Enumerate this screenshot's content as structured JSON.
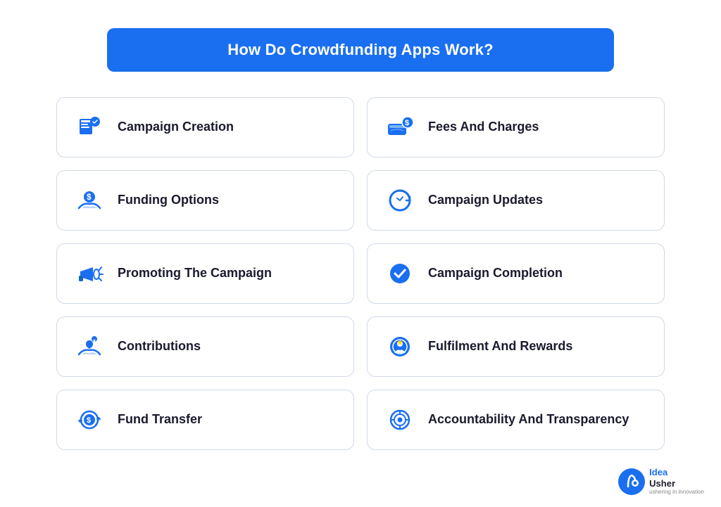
{
  "header": {
    "title": "How Do Crowdfunding Apps Work?"
  },
  "cards": [
    {
      "id": "campaign-creation",
      "label": "Campaign Creation",
      "icon": "campaign-creation-icon",
      "col": "left"
    },
    {
      "id": "fees-and-charges",
      "label": "Fees And Charges",
      "icon": "fees-icon",
      "col": "right"
    },
    {
      "id": "funding-options",
      "label": "Funding Options",
      "icon": "funding-options-icon",
      "col": "left"
    },
    {
      "id": "campaign-updates",
      "label": "Campaign Updates",
      "icon": "campaign-updates-icon",
      "col": "right"
    },
    {
      "id": "promoting-campaign",
      "label": "Promoting The Campaign",
      "icon": "promoting-icon",
      "col": "left"
    },
    {
      "id": "campaign-completion",
      "label": "Campaign Completion",
      "icon": "campaign-completion-icon",
      "col": "right"
    },
    {
      "id": "contributions",
      "label": "Contributions",
      "icon": "contributions-icon",
      "col": "left"
    },
    {
      "id": "fulfilment-rewards",
      "label": "Fulfilment And Rewards",
      "icon": "rewards-icon",
      "col": "right"
    },
    {
      "id": "fund-transfer",
      "label": "Fund Transfer",
      "icon": "fund-transfer-icon",
      "col": "left"
    },
    {
      "id": "accountability",
      "label": "Accountability And Transparency",
      "icon": "accountability-icon",
      "col": "right"
    }
  ],
  "logo": {
    "text1": "Idea",
    "text2": "Usher",
    "sub": "ushering in innovation"
  },
  "accent": "#1a6ff0"
}
